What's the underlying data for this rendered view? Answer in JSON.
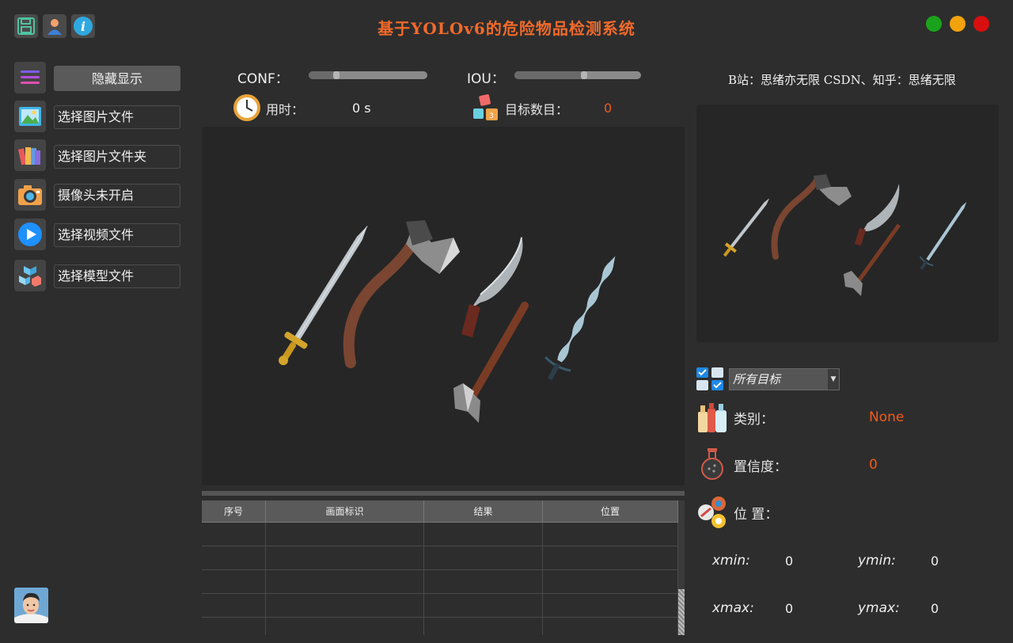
{
  "app": {
    "title": "基于YOLOv6的危险物品检测系统"
  },
  "window_controls": {
    "colors": [
      "#1aa31a",
      "#f2a20c",
      "#d90f0f"
    ]
  },
  "top_icons": [
    "save-icon",
    "user-icon",
    "info-icon"
  ],
  "sidebar": {
    "items": [
      {
        "label": "隐藏显示",
        "icon": "menu-icon"
      },
      {
        "label": "选择图片文件",
        "icon": "image-icon"
      },
      {
        "label": "选择图片文件夹",
        "icon": "folder-images-icon"
      },
      {
        "label": "摄像头未开启",
        "icon": "camera-icon"
      },
      {
        "label": "选择视频文件",
        "icon": "play-icon"
      },
      {
        "label": "选择模型文件",
        "icon": "cubes-icon"
      }
    ]
  },
  "controls": {
    "conf_label": "CONF：",
    "conf_level": 0.23,
    "iou_label": "IOU：",
    "iou_level": 0.55,
    "time_label": "用时：",
    "time_value": "0 s",
    "count_label": "目标数目：",
    "count_value": "0"
  },
  "credits": "B站：思绪亦无限  CSDN、知乎：思绪无限",
  "table": {
    "headers": [
      "序号",
      "画面标识",
      "结果",
      "位置"
    ],
    "rows": [
      [
        "",
        "",
        "",
        ""
      ],
      [
        "",
        "",
        "",
        ""
      ],
      [
        "",
        "",
        "",
        ""
      ],
      [
        "",
        "",
        "",
        ""
      ],
      [
        "",
        "",
        "",
        ""
      ]
    ]
  },
  "target_select": {
    "value": "所有目标"
  },
  "info": {
    "class_label": "类别：",
    "class_value": "None",
    "confidence_label": "置信度：",
    "confidence_value": "0",
    "position_label": "位 置："
  },
  "coords": {
    "xmin_label": "xmin:",
    "xmin": "0",
    "ymin_label": "ymin:",
    "ymin": "0",
    "xmax_label": "xmax:",
    "xmax": "0",
    "ymax_label": "ymax:",
    "ymax": "0"
  },
  "accent_color": "#f25a1a"
}
